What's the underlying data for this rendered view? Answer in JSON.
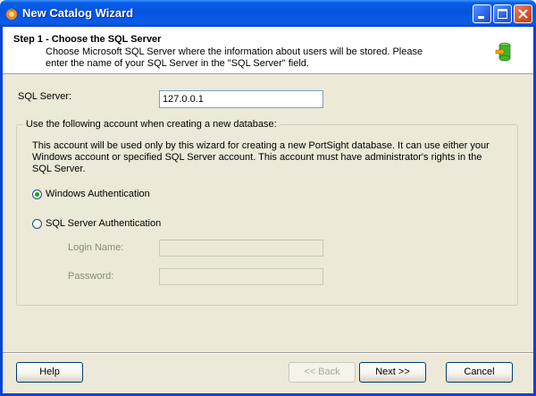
{
  "window": {
    "title": "New Catalog Wizard",
    "controls": {
      "minimize": "minimize-icon",
      "maximize": "maximize-icon",
      "close": "close-icon"
    }
  },
  "header": {
    "step_title": "Step 1 - Choose the SQL Server",
    "description": "Choose Microsoft SQL Server where the information about users will be stored. Please enter the name of your SQL Server in the \"SQL Server\" field.",
    "icon": "database-arrow-icon"
  },
  "form": {
    "sql_server_label": "SQL Server:",
    "sql_server_value": "127.0.0.1",
    "group_legend": "Use the following account when creating a new database:",
    "group_note": "This account will be used only by this wizard for creating a new PortSight database.  It can use either your Windows account or specified SQL Server account. This account must have administrator's rights in the SQL Server.",
    "auth_options": [
      {
        "label": "Windows Authentication",
        "selected": true
      },
      {
        "label": "SQL Server Authentication",
        "selected": false
      }
    ],
    "login_name_label": "Login Name:",
    "login_name_value": "",
    "password_label": "Password:",
    "password_value": ""
  },
  "buttons": {
    "help": "Help",
    "back": "<< Back",
    "next": "Next >>",
    "cancel": "Cancel"
  },
  "colors": {
    "titlebar": "#0554E0",
    "dialog_bg": "#ECE9D8",
    "radio_dot": "#21A121"
  }
}
